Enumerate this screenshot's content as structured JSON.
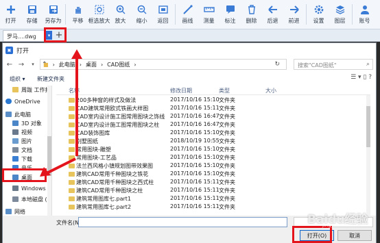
{
  "toolbar": {
    "buttons": [
      {
        "label": "打开",
        "icon": "plus-icon"
      },
      {
        "label": "存储",
        "icon": "save-icon"
      },
      {
        "label": "另存为",
        "icon": "save-as-icon"
      },
      {
        "label": "平移",
        "icon": "hand-icon"
      },
      {
        "label": "框选放大",
        "icon": "zoom-window-icon"
      },
      {
        "label": "放大",
        "icon": "zoom-in-icon"
      },
      {
        "label": "缩小",
        "icon": "zoom-out-icon"
      },
      {
        "label": "返回",
        "icon": "restore-icon"
      },
      {
        "label": "画线",
        "icon": "draw-line-icon"
      },
      {
        "label": "测量",
        "icon": "measure-icon"
      },
      {
        "label": "标注",
        "icon": "annotate-icon"
      },
      {
        "label": "删除",
        "icon": "delete-icon"
      },
      {
        "label": "后退",
        "icon": "undo-icon"
      },
      {
        "label": "前进",
        "icon": "redo-icon"
      },
      {
        "label": "设置",
        "icon": "gear-icon"
      },
      {
        "label": "图层",
        "icon": "layers-icon"
      },
      {
        "label": "账号",
        "icon": "account-icon"
      }
    ],
    "accent": "#3a7bd5"
  },
  "tabbar": {
    "doc_tab": "罗马....dwg",
    "drop": "▾",
    "plus": "+"
  },
  "dialog": {
    "title": "打开",
    "address": [
      "此电脑",
      "桌面",
      "CAD图纸"
    ],
    "search_placeholder": "搜索\"CAD图纸\"",
    "organize": "组织 ▾",
    "new_folder": "新建文件夹",
    "columns": {
      "name": "名称",
      "date": "修改日期",
      "type": "类型",
      "size": "大小"
    },
    "sidebar": [
      {
        "label": "周跋 工作报",
        "color": "#e8c45c"
      },
      {
        "label": "OneDrive",
        "color": "#2b78d0"
      },
      {
        "label": "此电脑",
        "color": "#5a8ec9"
      },
      {
        "label": "3D 对象",
        "color": "#4a86c8"
      },
      {
        "label": "视频",
        "color": "#6a7a8c"
      },
      {
        "label": "图片",
        "color": "#6a9cd0"
      },
      {
        "label": "文档",
        "color": "#7c8a9c"
      },
      {
        "label": "下载",
        "color": "#3b7fd4"
      },
      {
        "label": "音乐",
        "color": "#3b7fd4"
      },
      {
        "label": "桌面",
        "color": "#4a86c8"
      },
      {
        "label": "Windows (C",
        "color": "#6b7a8a"
      },
      {
        "label": "本地磁盘 (D",
        "color": "#7c8a9c"
      },
      {
        "label": "网络",
        "color": "#5a8ec9"
      }
    ],
    "files": [
      {
        "name": "200多种窗的样式及做法",
        "date": "2017/10/16 15:10",
        "type": "文件夹"
      },
      {
        "name": "CAD建筑常用欧式铁画大样图",
        "date": "2017/10/16 15:11",
        "type": "文件夹"
      },
      {
        "name": "CAD室内设计施工图常用图块之饰线",
        "date": "2017/10/16 16:47",
        "type": "文件夹"
      },
      {
        "name": "CAD室内设计施工图常用图块之柱",
        "date": "2017/10/16 16:47",
        "type": "文件夹"
      },
      {
        "name": "CAD装饰图库",
        "date": "2017/10/16 15:10",
        "type": "文件夹"
      },
      {
        "name": "别墅图纸",
        "date": "2018/10/19 10:55",
        "type": "文件夹"
      },
      {
        "name": "常用图块-雕塑",
        "date": "2017/10/16 15:10",
        "type": "文件夹"
      },
      {
        "name": "常用图块-工艺品",
        "date": "2017/10/16 15:10",
        "type": "文件夹"
      },
      {
        "name": "法兰西风格小镇规划图带效果图",
        "date": "2017/10/16 15:10",
        "type": "文件夹"
      },
      {
        "name": "建筑CAD常用千种图块之铁花",
        "date": "2017/10/16 15:10",
        "type": "文件夹"
      },
      {
        "name": "建筑CAD常用千种图块之西式柱",
        "date": "2017/10/16 15:11",
        "type": "文件夹"
      },
      {
        "name": "建筑CAD常用千种图块之柱",
        "date": "2017/10/16 15:11",
        "type": "文件夹"
      },
      {
        "name": "建筑常用图库七.part1",
        "date": "2017/10/16 15:11",
        "type": "文件夹"
      },
      {
        "name": "建筑常用图库七.part2",
        "date": "2017/10/16 15:11",
        "type": "文件夹"
      }
    ],
    "filename_label": "文件名(N):",
    "open_button": "打开(O)",
    "cancel_button": "取消"
  },
  "watermark": "Baidu经验",
  "watermark_sub": "jingyan.baidu.com"
}
